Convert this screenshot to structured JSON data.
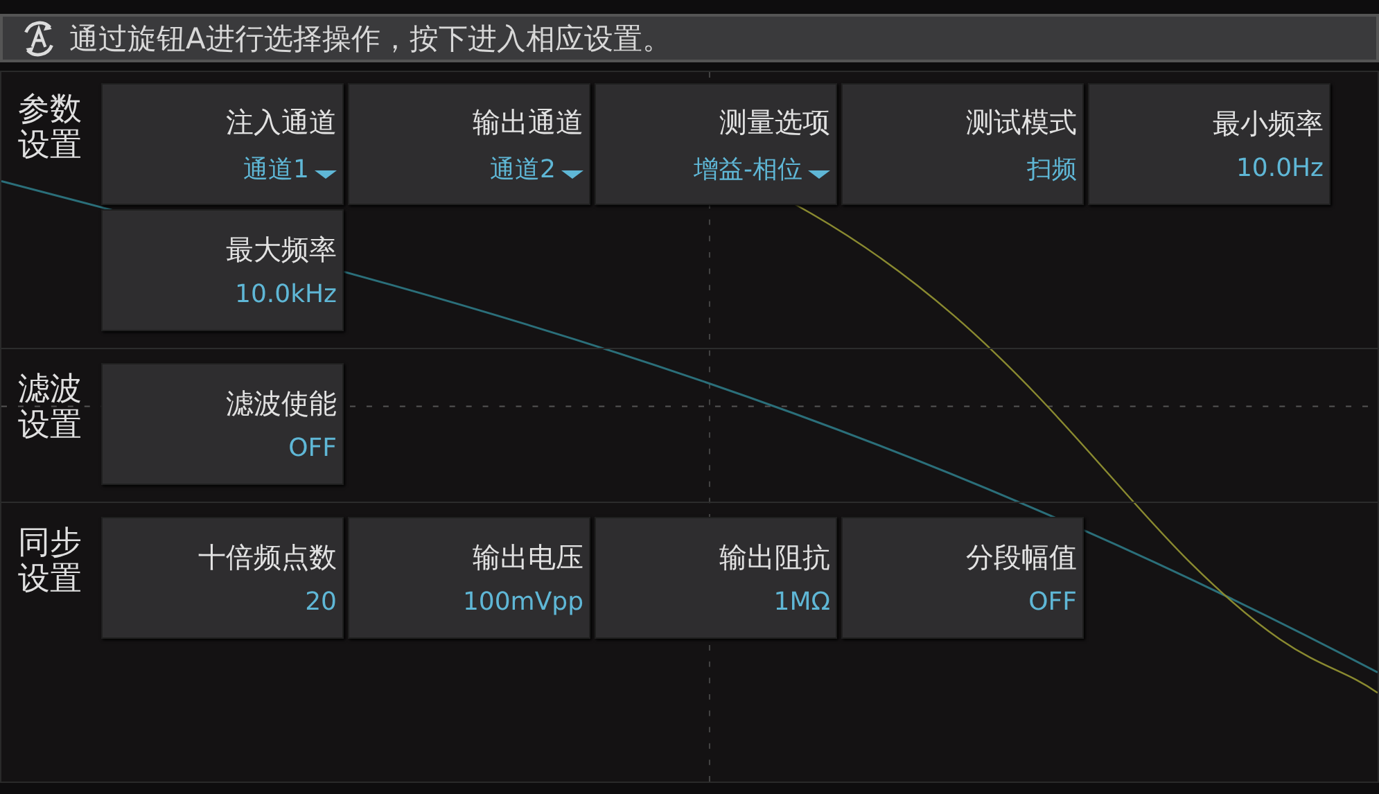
{
  "hint_bar": {
    "text": "通过旋钮A进行选择操作，按下进入相应设置。"
  },
  "sections": [
    {
      "title": "参数设置",
      "settings": [
        {
          "label": "注入通道",
          "value": "通道1",
          "kind": "dropdown"
        },
        {
          "label": "输出通道",
          "value": "通道2",
          "kind": "dropdown"
        },
        {
          "label": "测量选项",
          "value": "增益-相位",
          "kind": "dropdown"
        },
        {
          "label": "测试模式",
          "value": "扫频",
          "kind": "plain"
        },
        {
          "label": "最小频率",
          "value": "10.0Hz",
          "kind": "plain"
        },
        {
          "label": "最大频率",
          "value": "10.0kHz",
          "kind": "plain"
        }
      ]
    },
    {
      "title": "滤波设置",
      "settings": [
        {
          "label": "滤波使能",
          "value": "OFF",
          "kind": "plain"
        }
      ]
    },
    {
      "title": "同步设置",
      "settings": [
        {
          "label": "十倍频点数",
          "value": "20",
          "kind": "plain"
        },
        {
          "label": "输出电压",
          "value": "100mVpp",
          "kind": "plain"
        },
        {
          "label": "输出阻抗",
          "value": "1MΩ",
          "kind": "plain"
        },
        {
          "label": "分段幅值",
          "value": "OFF",
          "kind": "plain"
        }
      ]
    }
  ]
}
